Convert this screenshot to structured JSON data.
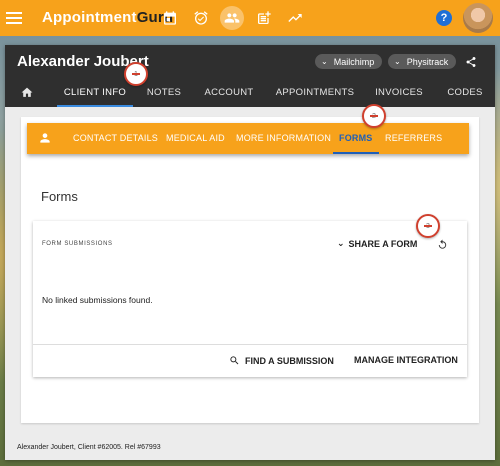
{
  "app": {
    "logo_main": "Appointment",
    "logo_accent": "Guru",
    "help_label": "?"
  },
  "colors": {
    "brand": "#f7a21b",
    "header": "#2f2f2f",
    "accent": "#1f5fb8",
    "annotation": "#d0402e"
  },
  "topnav": {
    "icons": [
      "calendar-icon",
      "alarm-icon",
      "people-icon",
      "post-add-icon",
      "trending-up-icon"
    ],
    "active": "people-icon"
  },
  "client": {
    "name": "Alexander Joubert",
    "chips": [
      "Mailchimp",
      "Physitrack"
    ]
  },
  "tabs": [
    "CLIENT INFO",
    "NOTES",
    "ACCOUNT",
    "APPOINTMENTS",
    "INVOICES",
    "CODES"
  ],
  "active_tab": "CLIENT INFO",
  "subtabs": [
    "CONTACT DETAILS",
    "MEDICAL AID",
    "MORE INFORMATION",
    "FORMS",
    "REFERRERS"
  ],
  "active_subtab": "FORMS",
  "forms": {
    "title": "Forms",
    "submissions_label": "FORM SUBMISSIONS",
    "share_label": "SHARE A FORM",
    "empty_text": "No linked submissions found.",
    "find_label": "FIND A SUBMISSION",
    "manage_label": "MANAGE INTEGRATION"
  },
  "footer": {
    "text": "Alexander Joubert, Client #62005. Rel #67993"
  },
  "annotations": [
    "1",
    "2",
    "3"
  ]
}
